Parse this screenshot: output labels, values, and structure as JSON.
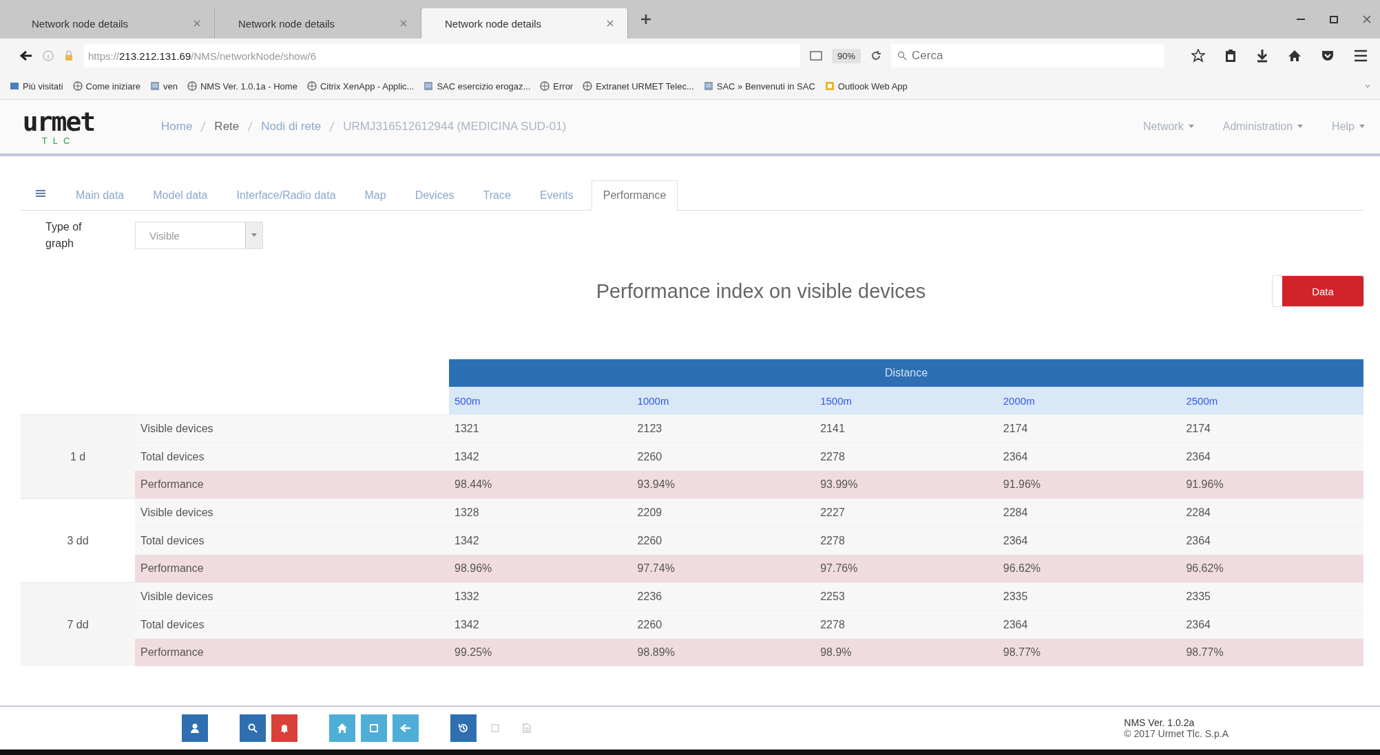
{
  "browser": {
    "tabs": [
      {
        "title": "Network node details",
        "selected": false
      },
      {
        "title": "Network node details",
        "selected": false
      },
      {
        "title": "Network node details",
        "selected": true
      }
    ],
    "url": {
      "prefix": "https://",
      "host": "213.212.131.69",
      "path": "/NMS/networkNode/show/6"
    },
    "zoom": "90%",
    "search_placeholder": "Cerca",
    "bookmarks": [
      {
        "label": "Più visitati",
        "kind": "folder"
      },
      {
        "label": "Come iniziare",
        "kind": "globe"
      },
      {
        "label": "ven",
        "kind": "page"
      },
      {
        "label": "NMS Ver. 1.0.1a - Home",
        "kind": "globe"
      },
      {
        "label": "Citrix XenApp - Applic...",
        "kind": "globe"
      },
      {
        "label": "SAC esercizio erogaz...",
        "kind": "page"
      },
      {
        "label": "Error",
        "kind": "globe"
      },
      {
        "label": "Extranet URMET Telec...",
        "kind": "globe"
      },
      {
        "label": "SAC » Benvenuti in SAC",
        "kind": "page"
      },
      {
        "label": "Outlook Web App",
        "kind": "outlook"
      }
    ]
  },
  "header": {
    "logo": "urmet",
    "logo_sub": "TLC",
    "breadcrumb": [
      {
        "label": "Home",
        "kind": "link"
      },
      {
        "label": "Rete",
        "kind": "current"
      },
      {
        "label": "Nodi di rete",
        "kind": "link"
      },
      {
        "label": "URMJ316512612944 (MEDICINA SUD-01)",
        "kind": "plain"
      }
    ],
    "menu": [
      "Network",
      "Administration",
      "Help"
    ]
  },
  "tabs": [
    {
      "label": "Main data",
      "selected": false
    },
    {
      "label": "Model data",
      "selected": false
    },
    {
      "label": "Interface/Radio data",
      "selected": false
    },
    {
      "label": "Map",
      "selected": false
    },
    {
      "label": "Devices",
      "selected": false
    },
    {
      "label": "Trace",
      "selected": false
    },
    {
      "label": "Events",
      "selected": false
    },
    {
      "label": "Performance",
      "selected": true
    }
  ],
  "type_of_graph": {
    "label": "Type of graph",
    "value": "Visible"
  },
  "title": "Performance index on visible devices",
  "data_button": "Data",
  "table": {
    "group_header": "Distance",
    "columns": [
      "500m",
      "1000m",
      "1500m",
      "2000m",
      "2500m"
    ],
    "groups": [
      {
        "period": "1 d",
        "rows": [
          {
            "kind": "count",
            "label": "Visible devices",
            "values": [
              "1321",
              "2123",
              "2141",
              "2174",
              "2174"
            ]
          },
          {
            "kind": "count",
            "label": "Total devices",
            "values": [
              "1342",
              "2260",
              "2278",
              "2364",
              "2364"
            ]
          },
          {
            "kind": "performance",
            "label": "Performance",
            "values": [
              "98.44%",
              "93.94%",
              "93.99%",
              "91.96%",
              "91.96%"
            ]
          }
        ]
      },
      {
        "period": "3 dd",
        "rows": [
          {
            "kind": "count",
            "label": "Visible devices",
            "values": [
              "1328",
              "2209",
              "2227",
              "2284",
              "2284"
            ]
          },
          {
            "kind": "count",
            "label": "Total devices",
            "values": [
              "1342",
              "2260",
              "2278",
              "2364",
              "2364"
            ]
          },
          {
            "kind": "performance",
            "label": "Performance",
            "values": [
              "98.96%",
              "97.74%",
              "97.76%",
              "96.62%",
              "96.62%"
            ]
          }
        ]
      },
      {
        "period": "7 dd",
        "rows": [
          {
            "kind": "count",
            "label": "Visible devices",
            "values": [
              "1332",
              "2236",
              "2253",
              "2335",
              "2335"
            ]
          },
          {
            "kind": "count",
            "label": "Total devices",
            "values": [
              "1342",
              "2260",
              "2278",
              "2364",
              "2364"
            ]
          },
          {
            "kind": "performance",
            "label": "Performance",
            "values": [
              "99.25%",
              "98.89%",
              "98.9%",
              "98.77%",
              "98.77%"
            ]
          }
        ]
      }
    ]
  },
  "footer": {
    "tools": [
      {
        "kind": "user",
        "color": "#2f6fb0"
      },
      {
        "kind": "gap"
      },
      {
        "kind": "search",
        "color": "#2f6fb0"
      },
      {
        "kind": "bell",
        "color": "#d9403a"
      },
      {
        "kind": "gap"
      },
      {
        "kind": "home",
        "color": "#4eaed8"
      },
      {
        "kind": "square",
        "color": "#4eaed8"
      },
      {
        "kind": "arrow",
        "color": "#4eaed8"
      },
      {
        "kind": "gap"
      },
      {
        "kind": "history",
        "color": "#2f6fb0"
      },
      {
        "kind": "blank",
        "color": "#ffffff"
      },
      {
        "kind": "doc",
        "color": "#ffffff"
      }
    ],
    "version": "NMS Ver. 1.0.2a",
    "copyright": "© 2017 Urmet Tlc. S.p.A"
  }
}
